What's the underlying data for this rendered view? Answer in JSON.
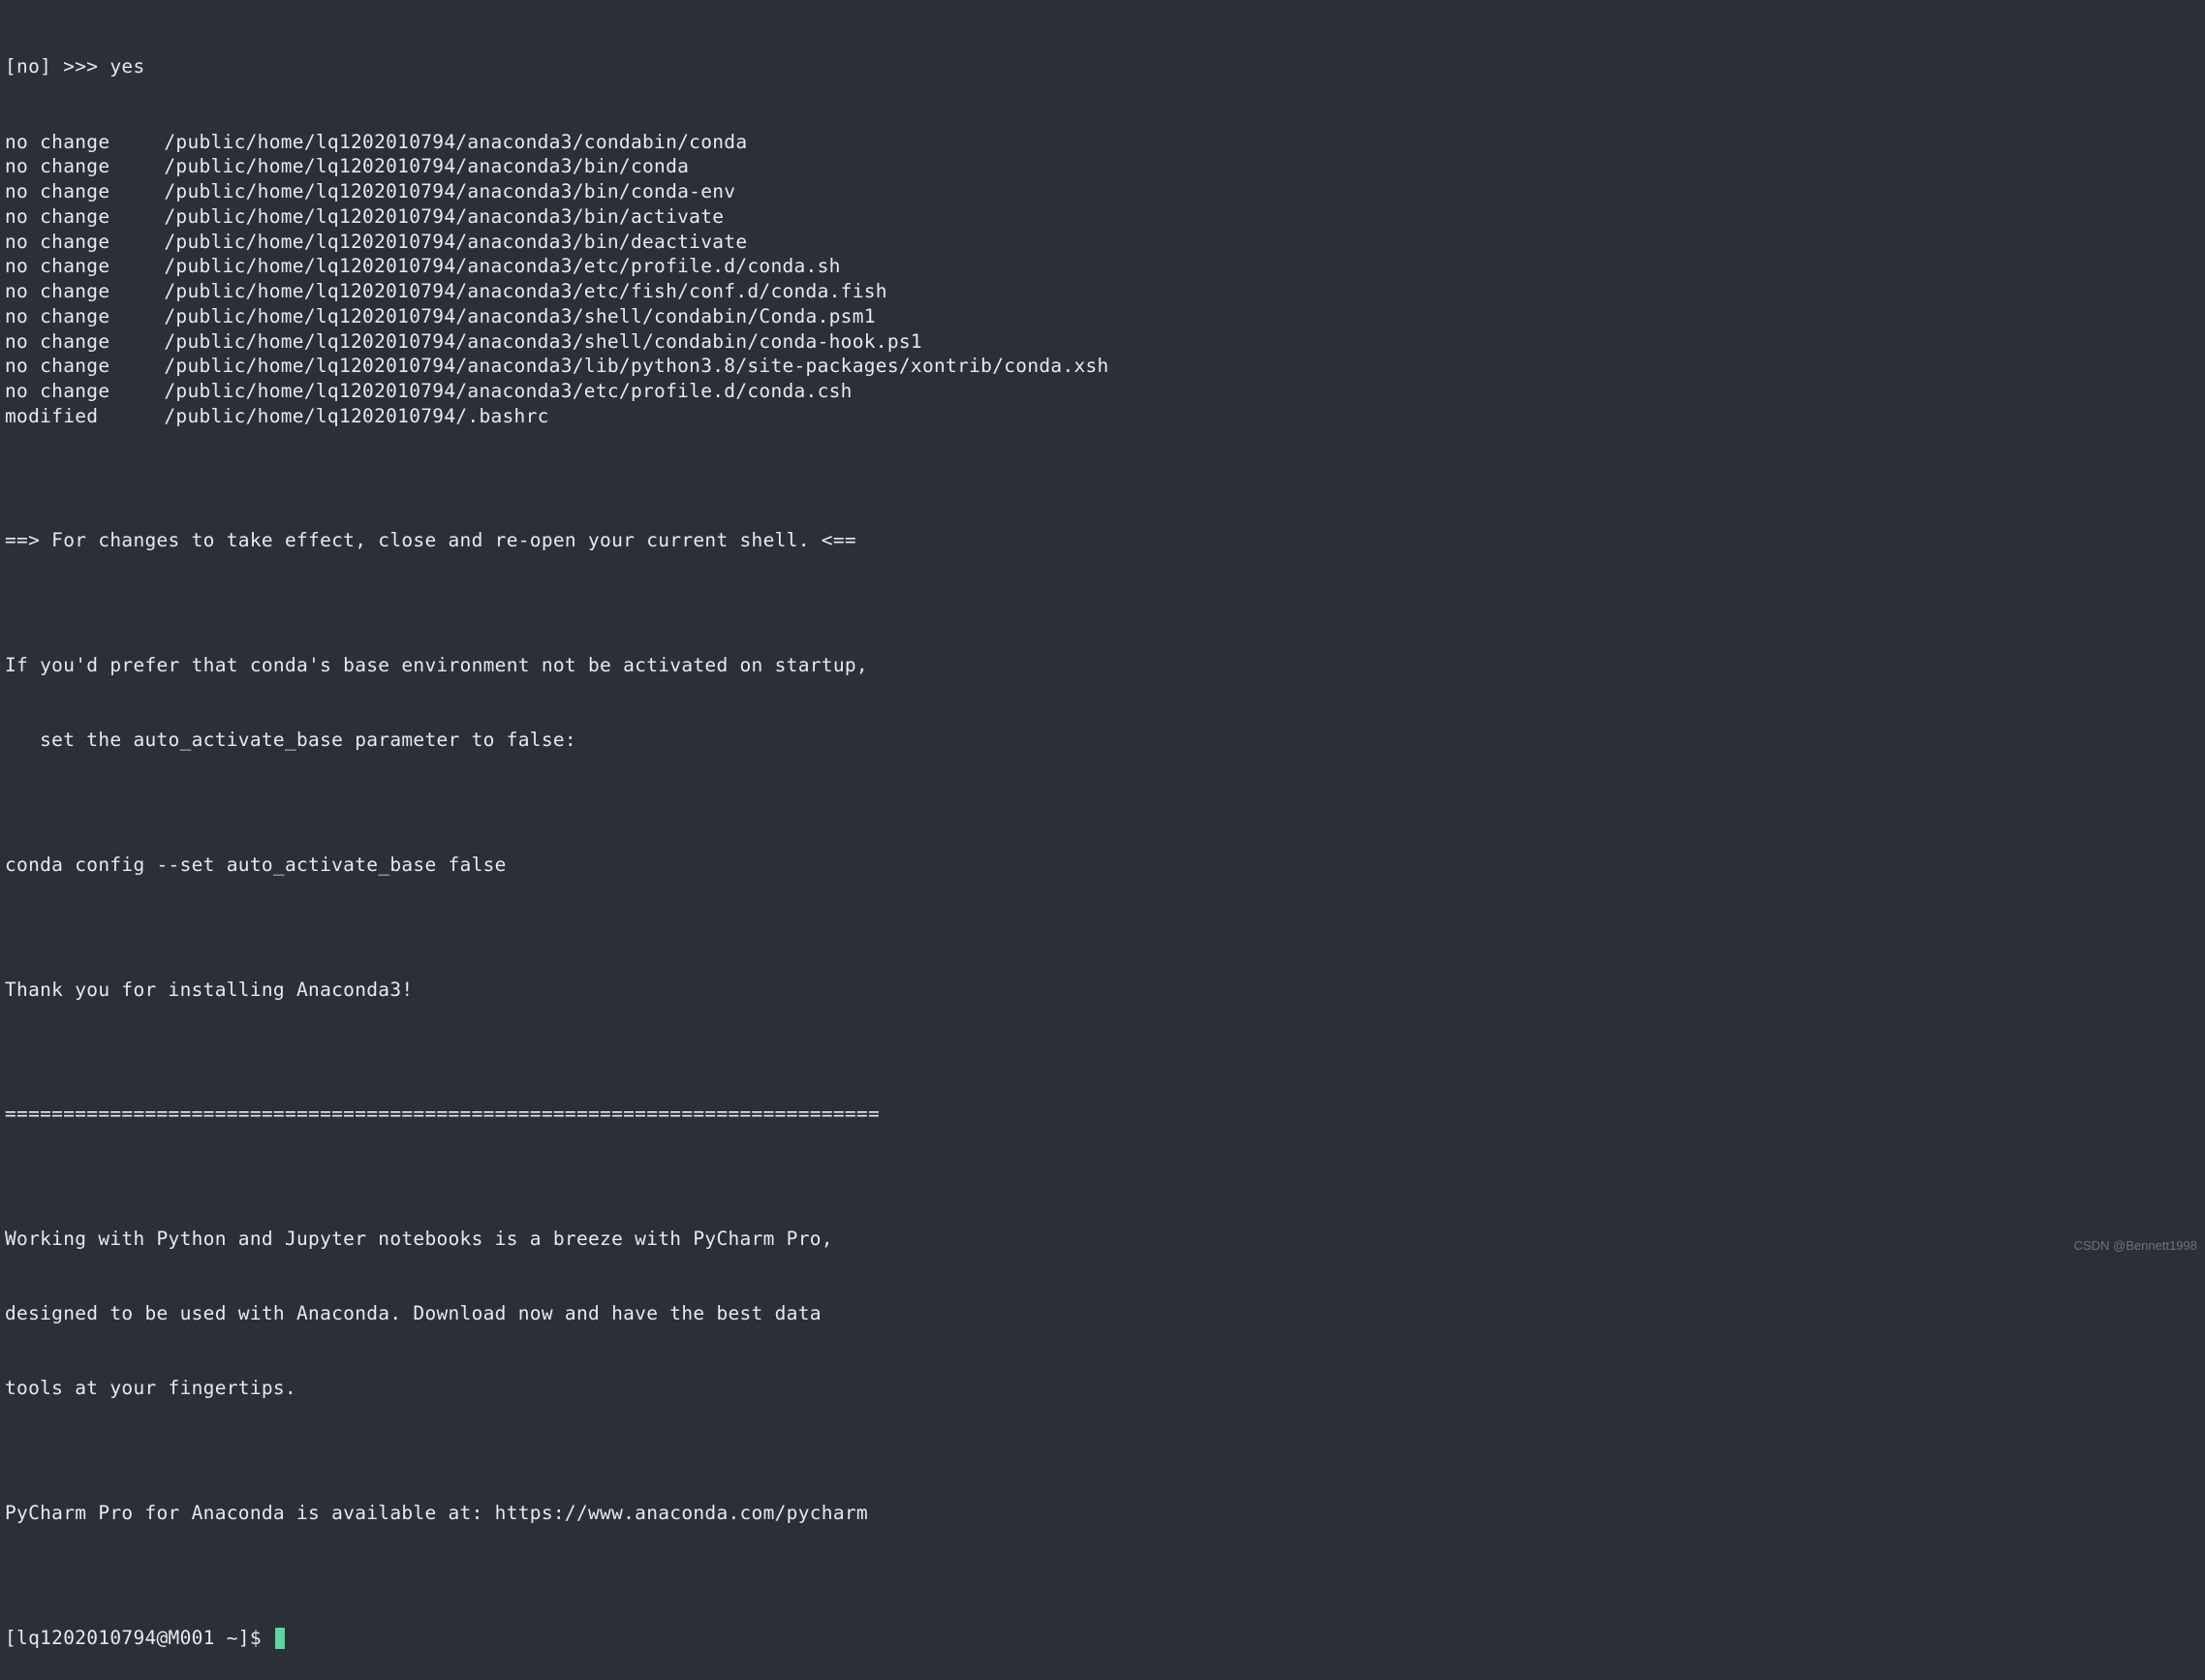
{
  "terminal": {
    "prompt_input": "[no] >>> yes",
    "file_changes": [
      {
        "status": "no change",
        "path": "/public/home/lq1202010794/anaconda3/condabin/conda"
      },
      {
        "status": "no change",
        "path": "/public/home/lq1202010794/anaconda3/bin/conda"
      },
      {
        "status": "no change",
        "path": "/public/home/lq1202010794/anaconda3/bin/conda-env"
      },
      {
        "status": "no change",
        "path": "/public/home/lq1202010794/anaconda3/bin/activate"
      },
      {
        "status": "no change",
        "path": "/public/home/lq1202010794/anaconda3/bin/deactivate"
      },
      {
        "status": "no change",
        "path": "/public/home/lq1202010794/anaconda3/etc/profile.d/conda.sh"
      },
      {
        "status": "no change",
        "path": "/public/home/lq1202010794/anaconda3/etc/fish/conf.d/conda.fish"
      },
      {
        "status": "no change",
        "path": "/public/home/lq1202010794/anaconda3/shell/condabin/Conda.psm1"
      },
      {
        "status": "no change",
        "path": "/public/home/lq1202010794/anaconda3/shell/condabin/conda-hook.ps1"
      },
      {
        "status": "no change",
        "path": "/public/home/lq1202010794/anaconda3/lib/python3.8/site-packages/xontrib/conda.xsh"
      },
      {
        "status": "no change",
        "path": "/public/home/lq1202010794/anaconda3/etc/profile.d/conda.csh"
      },
      {
        "status": "modified",
        "path": "/public/home/lq1202010794/.bashrc"
      }
    ],
    "blank1": "",
    "effect_msg": "==> For changes to take effect, close and re-open your current shell. <==",
    "blank2": "",
    "prefer_msg1": "If you'd prefer that conda's base environment not be activated on startup, ",
    "prefer_msg2": "   set the auto_activate_base parameter to false: ",
    "blank3": "",
    "conda_cmd": "conda config --set auto_activate_base false",
    "blank4": "",
    "thank_you": "Thank you for installing Anaconda3!",
    "blank5": "",
    "separator": "===========================================================================",
    "blank6": "",
    "pycharm_msg1": "Working with Python and Jupyter notebooks is a breeze with PyCharm Pro,",
    "pycharm_msg2": "designed to be used with Anaconda. Download now and have the best data",
    "pycharm_msg3": "tools at your fingertips.",
    "blank7": "",
    "pycharm_link": "PyCharm Pro for Anaconda is available at: https://www.anaconda.com/pycharm",
    "blank8": "",
    "shell_prompt": "[lq1202010794@M001 ~]$ "
  },
  "watermark": "CSDN @Bennett1998"
}
